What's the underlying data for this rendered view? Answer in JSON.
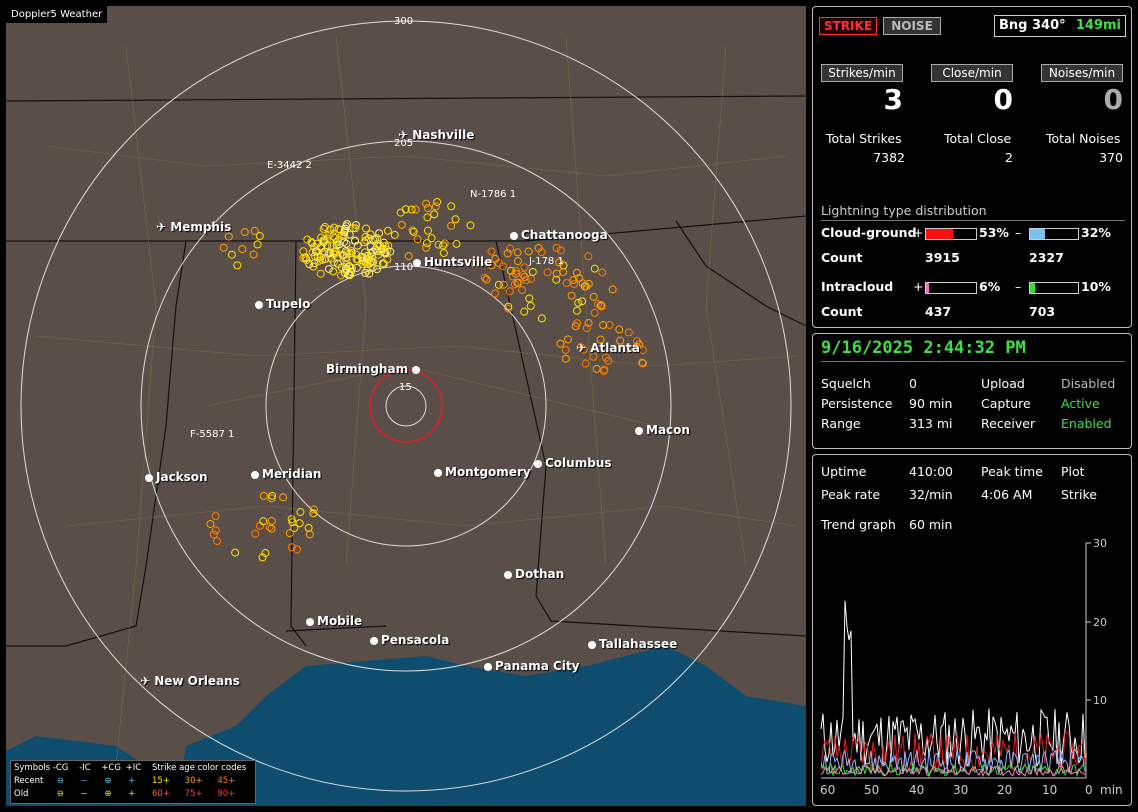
{
  "app_title": "Doppler5 Weather",
  "map": {
    "ring_labels": [
      "300",
      "205",
      "110",
      "15"
    ],
    "cities": [
      {
        "name": "Nashville",
        "airport": true
      },
      {
        "name": "Memphis",
        "airport": true
      },
      {
        "name": "Chattanooga",
        "airport": false
      },
      {
        "name": "Huntsville",
        "airport": false
      },
      {
        "name": "Tupelo",
        "airport": false
      },
      {
        "name": "Birmingham",
        "airport": false
      },
      {
        "name": "Atlanta",
        "airport": true
      },
      {
        "name": "Macon",
        "airport": false
      },
      {
        "name": "Jackson",
        "airport": false
      },
      {
        "name": "Meridian",
        "airport": false
      },
      {
        "name": "Montgomery",
        "airport": false
      },
      {
        "name": "Columbus",
        "airport": false
      },
      {
        "name": "Dothan",
        "airport": false
      },
      {
        "name": "Mobile",
        "airport": false
      },
      {
        "name": "Pensacola",
        "airport": false
      },
      {
        "name": "Tallahassee",
        "airport": false
      },
      {
        "name": "Panama City",
        "airport": false
      },
      {
        "name": "New Orleans",
        "airport": true
      }
    ],
    "storm_labels": [
      "E-3442 2",
      "N-1786 1",
      "J-178 1",
      "F-5587 1"
    ]
  },
  "legend": {
    "symbols": "Symbols",
    "neg_cg": "-CG",
    "neg_ic": "-IC",
    "pos_cg": "+CG",
    "pos_ic": "+IC",
    "age_title": "Strike age color codes",
    "recent": "Recent",
    "old": "Old",
    "ages": [
      "15+",
      "30+",
      "45+",
      "60+",
      "75+",
      "90+"
    ]
  },
  "header": {
    "strike_btn": "STRIKE",
    "noise_btn": "NOISE",
    "bearing": "Bng 340°",
    "distance": "149mi"
  },
  "rates": {
    "strikes_label": "Strikes/min",
    "close_label": "Close/min",
    "noises_label": "Noises/min",
    "strikes": "3",
    "close": "0",
    "noises": "0",
    "total_strikes_label": "Total Strikes",
    "total_close_label": "Total Close",
    "total_noises_label": "Total Noises",
    "total_strikes": "7382",
    "total_close": "2",
    "total_noises": "370"
  },
  "distribution": {
    "title": "Lightning type distribution",
    "cg_label": "Cloud-ground",
    "ic_label": "Intracloud",
    "count_label": "Count",
    "plus": "+",
    "minus": "–",
    "cg_pos_pct": "53%",
    "cg_neg_pct": "32%",
    "cg_pos_count": "3915",
    "cg_neg_count": "2327",
    "ic_pos_pct": "6%",
    "ic_neg_pct": "10%",
    "ic_pos_count": "437",
    "ic_neg_count": "703",
    "cg_pos_frac": 0.53,
    "cg_neg_frac": 0.32,
    "ic_pos_frac": 0.06,
    "ic_neg_frac": 0.1
  },
  "status": {
    "datetime": "9/16/2025 2:44:32 PM",
    "squelch_label": "Squelch",
    "squelch": "0",
    "upload_label": "Upload",
    "upload": "Disabled",
    "persistence_label": "Persistence",
    "persistence": "90 min",
    "capture_label": "Capture",
    "capture": "Active",
    "range_label": "Range",
    "range": "313 mi",
    "receiver_label": "Receiver",
    "receiver": "Enabled"
  },
  "stats": {
    "uptime_label": "Uptime",
    "uptime": "410:00",
    "peak_time_label": "Peak time",
    "plot_label": "Plot",
    "peak_rate_label": "Peak rate",
    "peak_rate": "32/min",
    "peak_time": "4:06 AM",
    "plot": "Strike",
    "trend_label": "Trend graph",
    "trend_value": "60 min",
    "y_ticks": [
      "30",
      "20",
      "10"
    ],
    "x_ticks": [
      "60",
      "50",
      "40",
      "30",
      "20",
      "10",
      "0"
    ],
    "x_unit": "min"
  }
}
